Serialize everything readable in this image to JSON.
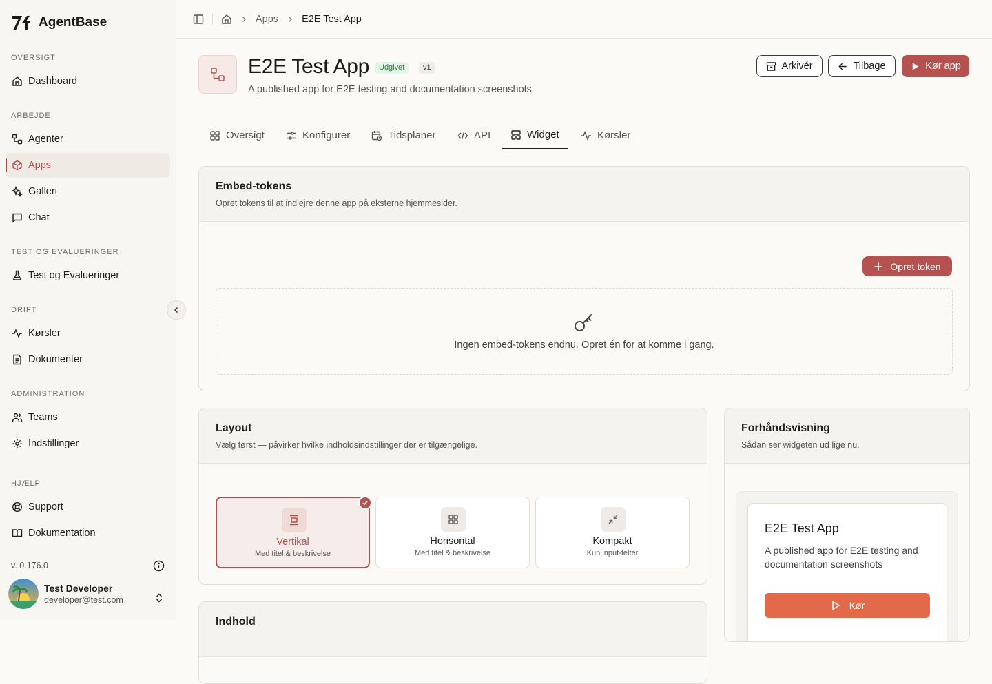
{
  "brand": {
    "name": "AgentBase"
  },
  "sidebar": {
    "sections": {
      "overview": "OVERSIGT",
      "work": "ARBEJDE",
      "test": "TEST OG EVALUERINGER",
      "ops": "DRIFT",
      "admin": "ADMINISTRATION",
      "help": "HJÆLP"
    },
    "items": {
      "dashboard": "Dashboard",
      "agents": "Agenter",
      "apps": "Apps",
      "gallery": "Galleri",
      "chat": "Chat",
      "tests": "Test og Evalueringer",
      "runs": "Kørsler",
      "docs": "Dokumenter",
      "teams": "Teams",
      "settings": "Indstillinger",
      "support": "Support",
      "documentation": "Dokumentation"
    },
    "version": "v. 0.176.0",
    "user": {
      "name": "Test Developer",
      "email": "developer@test.com"
    }
  },
  "breadcrumb": {
    "apps": "Apps",
    "current": "E2E Test App"
  },
  "app": {
    "title": "E2E Test App",
    "status_badge": "Udgivet",
    "version_badge": "v1",
    "description": "A published app for E2E testing and documentation screenshots"
  },
  "actions": {
    "archive": "Arkivér",
    "back": "Tilbage",
    "run": "Kør app"
  },
  "tabs": {
    "overview": "Oversigt",
    "configure": "Konfigurer",
    "schedules": "Tidsplaner",
    "api": "API",
    "widget": "Widget",
    "runs": "Kørsler"
  },
  "embed": {
    "title": "Embed-tokens",
    "subtitle": "Opret tokens til at indlejre denne app på eksterne hjemmesider.",
    "create_button": "Opret token",
    "empty_text": "Ingen embed-tokens endnu. Opret én for at komme i gang."
  },
  "layout": {
    "title": "Layout",
    "subtitle": "Vælg først — påvirker hvilke indholdsindstillinger der er tilgængelige.",
    "options": [
      {
        "label": "Vertikal",
        "sub": "Med titel & beskrivelse",
        "selected": true
      },
      {
        "label": "Horisontal",
        "sub": "Med titel & beskrivelse",
        "selected": false
      },
      {
        "label": "Kompakt",
        "sub": "Kun input-felter",
        "selected": false
      }
    ]
  },
  "content": {
    "title": "Indhold"
  },
  "preview": {
    "title": "Forhåndsvisning",
    "subtitle": "Sådan ser widgeten ud lige nu.",
    "widget_title": "E2E Test App",
    "widget_desc": "A published app for E2E testing and documentation screenshots",
    "run_button": "Kør"
  },
  "colors": {
    "accent": "#b5524f",
    "widget_button": "#e2694a",
    "published": "#2e7d3a"
  }
}
